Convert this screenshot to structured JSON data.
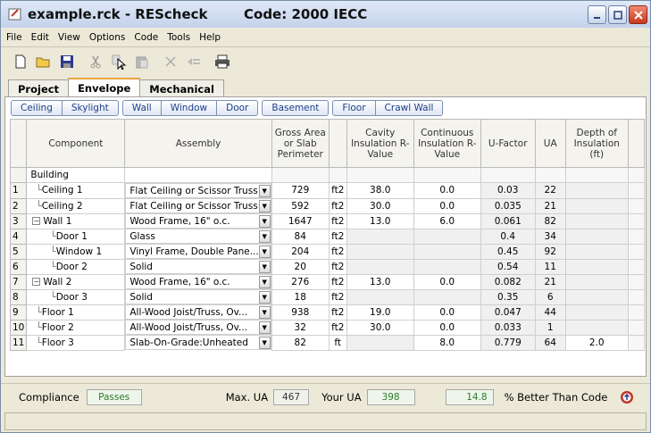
{
  "window": {
    "title": "example.rck - REScheck",
    "code": "Code: 2000 IECC"
  },
  "menu": [
    "File",
    "Edit",
    "View",
    "Options",
    "Code",
    "Tools",
    "Help"
  ],
  "toolbar_icons": [
    "new-file-icon",
    "open-folder-icon",
    "save-icon",
    "cut-icon",
    "copy-icon",
    "paste-icon",
    "delete-icon",
    "clear-icon",
    "print-icon"
  ],
  "tabs": [
    {
      "label": "Project",
      "active": false
    },
    {
      "label": "Envelope",
      "active": true
    },
    {
      "label": "Mechanical",
      "active": false
    }
  ],
  "envelope_buttons": [
    "Ceiling",
    "Skylight",
    "Wall",
    "Window",
    "Door",
    "Basement",
    "Floor",
    "Crawl Wall"
  ],
  "table": {
    "headers": {
      "component": "Component",
      "assembly": "Assembly",
      "gross": "Gross Area or Slab Perimeter",
      "cavity": "Cavity Insulation R-Value",
      "continuous": "Continuous Insulation R-Value",
      "ufactor": "U-Factor",
      "ua": "UA",
      "depth": "Depth of Insulation (ft)"
    },
    "group_label": "Building",
    "rows": [
      {
        "n": "1",
        "component": "Ceiling 1",
        "level": 1,
        "assembly": "Flat Ceiling or Scissor Truss",
        "gross": "729",
        "unit": "ft2",
        "cavity": "38.0",
        "continuous": "0.0",
        "ufactor": "0.03",
        "ua": "22",
        "depth": ""
      },
      {
        "n": "2",
        "component": "Ceiling 2",
        "level": 1,
        "assembly": "Flat Ceiling or Scissor Truss",
        "gross": "592",
        "unit": "ft2",
        "cavity": "30.0",
        "continuous": "0.0",
        "ufactor": "0.035",
        "ua": "21",
        "depth": ""
      },
      {
        "n": "3",
        "component": "Wall 1",
        "level": 0,
        "expander": "−",
        "assembly": "Wood Frame, 16\" o.c.",
        "gross": "1647",
        "unit": "ft2",
        "cavity": "13.0",
        "continuous": "6.0",
        "ufactor": "0.061",
        "ua": "82",
        "depth": ""
      },
      {
        "n": "4",
        "component": "Door 1",
        "level": 2,
        "assembly": "Glass",
        "gross": "84",
        "unit": "ft2",
        "cavity": "",
        "continuous": "",
        "ufactor": "0.4",
        "ua": "34",
        "depth": ""
      },
      {
        "n": "5",
        "component": "Window 1",
        "level": 2,
        "assembly": "Vinyl Frame, Double Pane...",
        "gross": "204",
        "unit": "ft2",
        "cavity": "",
        "continuous": "",
        "ufactor": "0.45",
        "ua": "92",
        "depth": ""
      },
      {
        "n": "6",
        "component": "Door 2",
        "level": 2,
        "assembly": "Solid",
        "gross": "20",
        "unit": "ft2",
        "cavity": "",
        "continuous": "",
        "ufactor": "0.54",
        "ua": "11",
        "depth": ""
      },
      {
        "n": "7",
        "component": "Wall 2",
        "level": 0,
        "expander": "−",
        "assembly": "Wood Frame, 16\" o.c.",
        "gross": "276",
        "unit": "ft2",
        "cavity": "13.0",
        "continuous": "0.0",
        "ufactor": "0.082",
        "ua": "21",
        "depth": ""
      },
      {
        "n": "8",
        "component": "Door 3",
        "level": 2,
        "assembly": "Solid",
        "gross": "18",
        "unit": "ft2",
        "cavity": "",
        "continuous": "",
        "ufactor": "0.35",
        "ua": "6",
        "depth": ""
      },
      {
        "n": "9",
        "component": "Floor 1",
        "level": 1,
        "assembly": "All-Wood Joist/Truss, Ov...",
        "gross": "938",
        "unit": "ft2",
        "cavity": "19.0",
        "continuous": "0.0",
        "ufactor": "0.047",
        "ua": "44",
        "depth": ""
      },
      {
        "n": "10",
        "component": "Floor 2",
        "level": 1,
        "assembly": "All-Wood Joist/Truss, Ov...",
        "gross": "32",
        "unit": "ft2",
        "cavity": "30.0",
        "continuous": "0.0",
        "ufactor": "0.033",
        "ua": "1",
        "depth": ""
      },
      {
        "n": "11",
        "component": "Floor 3",
        "level": 1,
        "assembly": "Slab-On-Grade:Unheated",
        "gross": "82",
        "unit": "ft",
        "cavity": "",
        "continuous": "8.0",
        "ufactor": "0.779",
        "ua": "64",
        "depth": "2.0"
      }
    ]
  },
  "compliance": {
    "label": "Compliance",
    "status": "Passes",
    "max_ua_label": "Max. UA",
    "max_ua": "467",
    "your_ua_label": "Your UA",
    "your_ua": "398",
    "pct_better": "14.8",
    "pct_label": "% Better Than Code"
  },
  "colors": {
    "accent_tab": "#e8a33c",
    "button_text": "#1d3f8a",
    "pass_green": "#2f7a2c"
  }
}
